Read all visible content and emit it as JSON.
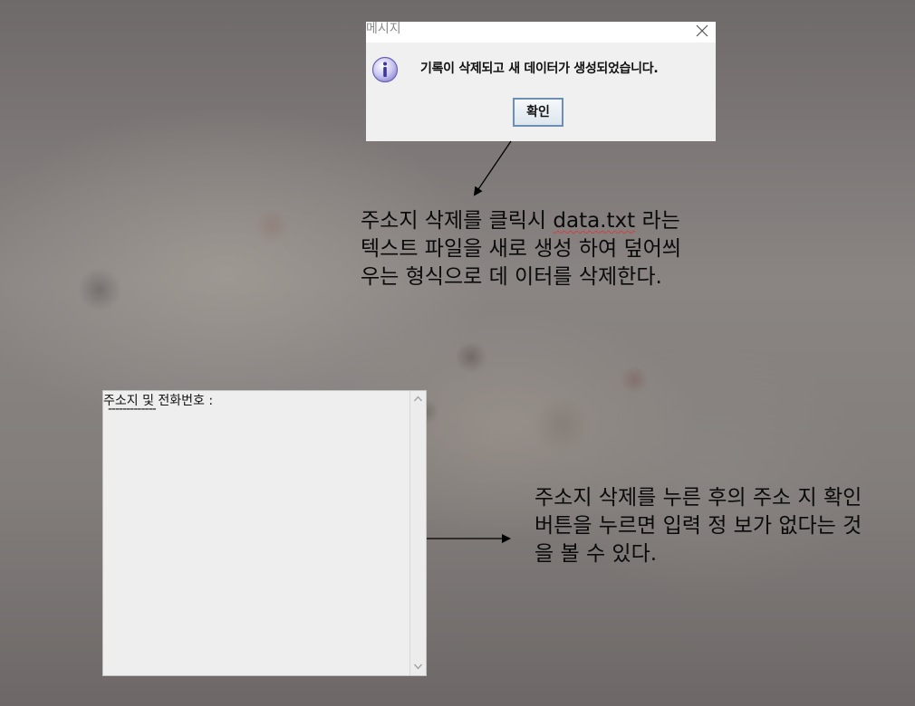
{
  "dialog": {
    "title": "메시지",
    "message": "기록이 삭제되고 새 데이터가 생성되었습니다.",
    "ok_label": "확인",
    "icon": "info-icon"
  },
  "annotation_top": {
    "text_before": "주소지 삭제를 클릭시 ",
    "text_underlined": "data.txt",
    "text_after": " 라는 텍스트 파일을 새로 생성 하여 덮어씌우는 형식으로 데 이터를 삭제한다."
  },
  "address_area": {
    "header": "주소지 및 전화번호 :",
    "separator": "-------------"
  },
  "annotation_bottom": {
    "text": "주소지 삭제를 누른 후의 주소 지 확인 버튼을 누르면 입력 정 보가 없다는 것을 볼 수 있다."
  },
  "colors": {
    "dialog_bg": "#f0f0f0",
    "textarea_bg": "#eeeeee",
    "ok_border": "#6e8fb4"
  }
}
